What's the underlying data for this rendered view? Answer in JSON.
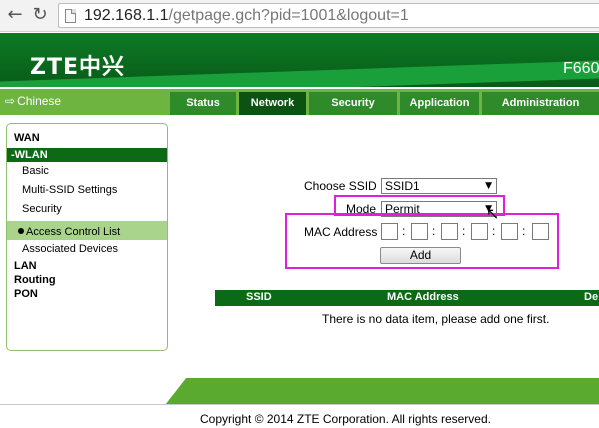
{
  "browser": {
    "back_icon": "←",
    "reload_icon": "↻",
    "url_host": "192.168.1.1",
    "url_path": "/getpage.gch?pid=1001&logout=1"
  },
  "header": {
    "logo": "ZTE中兴",
    "model": "F660"
  },
  "language_link": "Chinese",
  "tabs": [
    {
      "label": "Status",
      "active": false
    },
    {
      "label": "Network",
      "active": true
    },
    {
      "label": "Security",
      "active": false
    },
    {
      "label": "Application",
      "active": false
    },
    {
      "label": "Administration",
      "active": false
    }
  ],
  "sidebar": {
    "wan": "WAN",
    "wlan": "-WLAN",
    "basic": "Basic",
    "multi_ssid": "Multi-SSID Settings",
    "security": "Security",
    "acl": "Access Control List",
    "associated": "Associated Devices",
    "lan": "LAN",
    "routing": "Routing",
    "pon": "PON"
  },
  "form": {
    "choose_ssid_label": "Choose SSID",
    "ssid_value": "SSID1",
    "mode_label": "Mode",
    "mode_value": "Permit",
    "mac_label": "MAC Address",
    "mac_separator": ":",
    "add_button": "Add"
  },
  "table": {
    "col_ssid": "SSID",
    "col_mac": "MAC Address",
    "col_partial": "De",
    "empty_message": "There is no data item, please add one first."
  },
  "footer": {
    "copyright": "Copyright © 2014 ZTE Corporation. All rights reserved."
  },
  "colors": {
    "header_green": "#0e7a25",
    "menu_green": "#6eb441",
    "active_tab": "#0c5212",
    "highlight_magenta": "#e020d8"
  }
}
